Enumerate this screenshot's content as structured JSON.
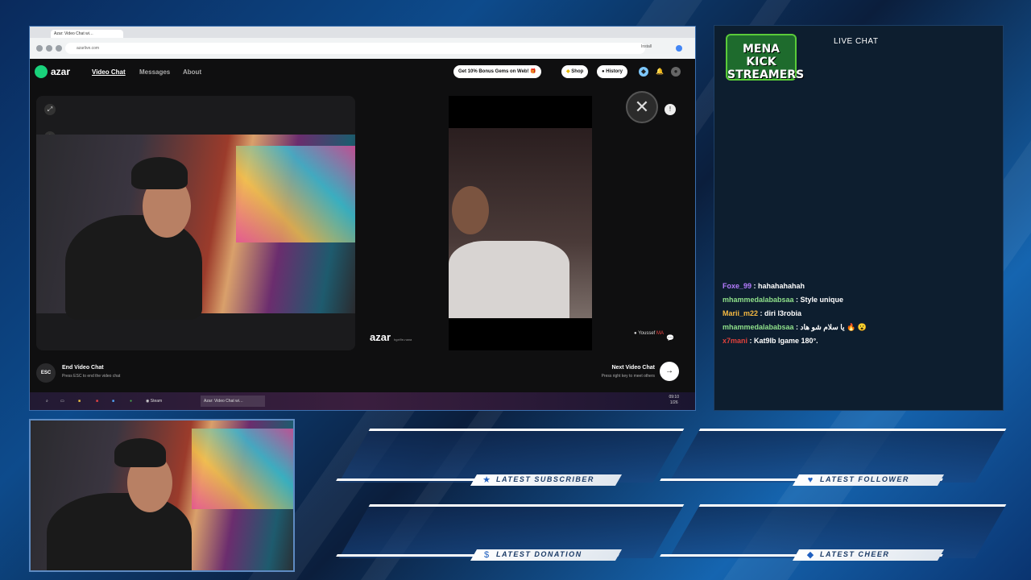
{
  "browser": {
    "tab_label": "Azar: Video Chat wi…",
    "url": "azarlive.com",
    "install_label": "Install"
  },
  "app": {
    "brand": "azar",
    "nav": [
      {
        "label": "Video Chat",
        "active": true
      },
      {
        "label": "Messages",
        "active": false
      },
      {
        "label": "About",
        "active": false
      }
    ],
    "promo_label": "Get 10% Bonus Gems on Web!",
    "shop_label": "Shop",
    "history_label": "History"
  },
  "peer": {
    "name": "Youssef",
    "country": "MA",
    "watermark": "azar",
    "watermark_sub": "hgxt9e-nana"
  },
  "bottom": {
    "esc_label": "ESC",
    "end_title": "End Video Chat",
    "end_sub": "Press ESC to end the video chat",
    "next_title": "Next Video Chat",
    "next_sub": "Press right key to meet others"
  },
  "taskbar": {
    "steam_label": "Steam",
    "chrome_label": "Azar: Video Chat wi…",
    "time": "09:10",
    "date": "1/26"
  },
  "chat": {
    "logo_text": "MENA KICK STREAMERS",
    "title": "LIVE CHAT",
    "messages": [
      {
        "user": "Foxe_99",
        "color": "#b57cff",
        "text": "hahahahahah"
      },
      {
        "user": "mhammedalababsaa",
        "color": "#8fe08a",
        "text": "Style unique"
      },
      {
        "user": "Marii_m22",
        "color": "#f5b942",
        "text": "diri l3robia"
      },
      {
        "user": "mhammedalababsaa",
        "color": "#8fe08a",
        "text": "يا سلام شو هاد 🔥 😮"
      },
      {
        "user": "x7mani",
        "color": "#e0413b",
        "text": "Kat9lb lgame 180°."
      }
    ]
  },
  "labels": {
    "subscriber": "LATEST SUBSCRIBER",
    "follower": "LATEST FOLLOWER",
    "donation": "LATEST DONATION",
    "cheer": "LATEST CHEER"
  }
}
